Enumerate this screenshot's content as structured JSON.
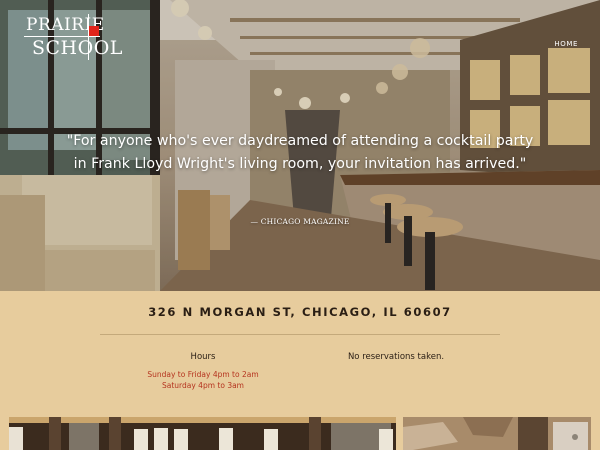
{
  "brand": {
    "line1": "PRAIRIE",
    "line2": "SCHOOL"
  },
  "nav": {
    "home": "HOME"
  },
  "hero": {
    "quote": "\"For anyone who's ever daydreamed of attending a cocktail party in Frank Lloyd Wright's living room, your invitation has arrived.\"",
    "attribution": "— CHICAGO MAGAZINE"
  },
  "info": {
    "address": "326 N MORGAN ST, CHICAGO, IL 60607",
    "hours_title": "Hours",
    "hours": [
      "Sunday to Friday 4pm to 2am",
      "Saturday 4pm to 3am"
    ],
    "reservations": "No reservations taken."
  },
  "colors": {
    "background": "#e7cc9d",
    "hours_text": "#b5341f",
    "logo_accent": "#e1251b",
    "heading": "#2a1e14"
  }
}
